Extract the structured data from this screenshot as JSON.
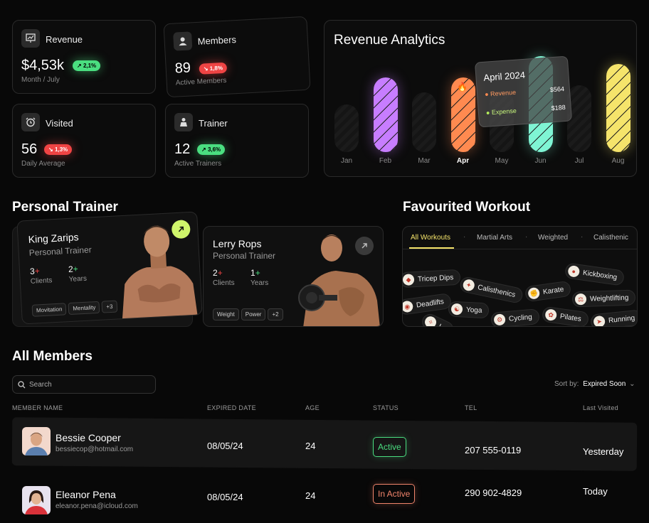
{
  "stats": {
    "revenue": {
      "title": "Revenue",
      "value": "$4,53k",
      "change": "2,1%",
      "subtitle": "Month / July"
    },
    "members": {
      "title": "Members",
      "value": "89",
      "change": "1,8%",
      "subtitle": "Active Members"
    },
    "visited": {
      "title": "Visited",
      "value": "56",
      "change": "1,3%",
      "subtitle": "Daily Average"
    },
    "trainer": {
      "title": "Trainer",
      "value": "12",
      "change": "3,6%",
      "subtitle": "Active Trainers"
    }
  },
  "analytics": {
    "title": "Revenue Analytics",
    "tooltip": {
      "month": "April 2024",
      "revenue_label": "Revenue",
      "revenue_value": "$564",
      "expense_label": "Expense",
      "expense_value": "$188"
    },
    "colors": {
      "feb": "#c77dff",
      "apr": "#ff8a50",
      "jun": "#7ff5d4",
      "aug": "#f5e46b"
    }
  },
  "chart_data": {
    "type": "bar",
    "title": "Revenue Analytics",
    "categories": [
      "Jan",
      "Feb",
      "Mar",
      "Apr",
      "May",
      "Jun",
      "Jul",
      "Aug"
    ],
    "values": [
      50,
      78,
      62,
      78,
      64,
      100,
      70,
      92
    ],
    "highlighted": "Apr",
    "tooltip": {
      "month": "April 2024",
      "Revenue": 564,
      "Expense": 188
    }
  },
  "personal_trainer": {
    "title": "Personal Trainer",
    "cards": [
      {
        "name": "King Zarips",
        "role": "Personal Trainer",
        "clients": "3",
        "clients_label": "Clients",
        "years": "2",
        "years_label": "Years",
        "tags": [
          "Movitation",
          "Mentality"
        ],
        "more": "+3"
      },
      {
        "name": "Lerry Rops",
        "role": "Personal Trainer",
        "clients": "2",
        "clients_label": "Clients",
        "years": "1",
        "years_label": "Years",
        "tags": [
          "Weight",
          "Power"
        ],
        "more": "+2"
      }
    ]
  },
  "workout": {
    "title": "Favourited Workout",
    "tabs": [
      "All Workouts",
      "Martial Arts",
      "Weighted",
      "Calisthenic"
    ],
    "chips": [
      "Tricep Dips",
      "Calisthenics",
      "Karate",
      "Kickboxing",
      "Weightlifting",
      "Deadlifts",
      "Yoga",
      "Cycling",
      "Pilates",
      "Running",
      "Lu"
    ]
  },
  "members": {
    "title": "All Members",
    "search_placeholder": "Search",
    "sort_label": "Sort by:",
    "sort_value": "Expired Soon",
    "columns": [
      "MEMBER NAME",
      "EXPIRED DATE",
      "AGE",
      "STATUS",
      "TEL",
      "Last Visited"
    ],
    "rows": [
      {
        "name": "Bessie Cooper",
        "email": "bessiecop@hotmail.com",
        "expired": "08/05/24",
        "age": "24",
        "status": "Active",
        "tel": "207 555-0119",
        "last": "Yesterday"
      },
      {
        "name": "Eleanor Pena",
        "email": "eleanor.pena@icloud.com",
        "expired": "08/05/24",
        "age": "24",
        "status": "In Active",
        "tel": "290 902-4829",
        "last": "Today"
      }
    ]
  }
}
